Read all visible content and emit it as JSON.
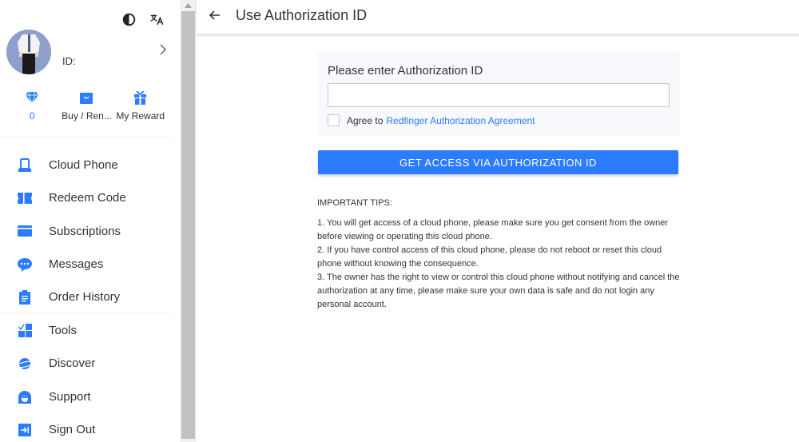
{
  "sidebar": {
    "top_icons": [
      "contrast-icon",
      "translate-icon"
    ],
    "profile": {
      "id_label": "ID:"
    },
    "quick": [
      {
        "icon": "diamond-icon",
        "label": "0",
        "color": "#2b7cff"
      },
      {
        "icon": "shopping-bag-icon",
        "label": "Buy / Ren..."
      },
      {
        "icon": "gift-icon",
        "label": "My Reward"
      }
    ],
    "nav": [
      {
        "icon": "cloud-phone-icon",
        "label": "Cloud Phone"
      },
      {
        "icon": "ticket-icon",
        "label": "Redeem Code"
      },
      {
        "icon": "card-icon",
        "label": "Subscriptions"
      },
      {
        "icon": "message-icon",
        "label": "Messages"
      },
      {
        "icon": "clipboard-icon",
        "label": "Order History"
      },
      {
        "icon": "tools-icon",
        "label": "Tools"
      },
      {
        "icon": "planet-icon",
        "label": "Discover"
      },
      {
        "icon": "support-icon",
        "label": "Support"
      },
      {
        "icon": "sign-out-icon",
        "label": "Sign Out"
      }
    ]
  },
  "header": {
    "title": "Use Authorization ID"
  },
  "form": {
    "label": "Please enter Authorization ID",
    "input_value": "",
    "checkbox_checked": false,
    "agree_text": "Agree to",
    "agree_link": "Redfinger Authorization Agreement",
    "button_label": "GET ACCESS VIA AUTHORIZATION ID"
  },
  "tips": {
    "title": "IMPORTANT TIPS:",
    "items": [
      "1. You will get access of a cloud phone, please make sure you get consent from the owner before viewing or operating this cloud phone.",
      "2. If you have control access of this cloud phone, please do not reboot or reset this cloud phone without knowing the consequence.",
      "3. The owner has the right to view or control this cloud phone without notifying and cancel the authorization at any time, please make sure your own data is safe and do not login any personal account."
    ]
  },
  "colors": {
    "accent": "#2b7cff",
    "card_bg": "#f8f9fd"
  }
}
